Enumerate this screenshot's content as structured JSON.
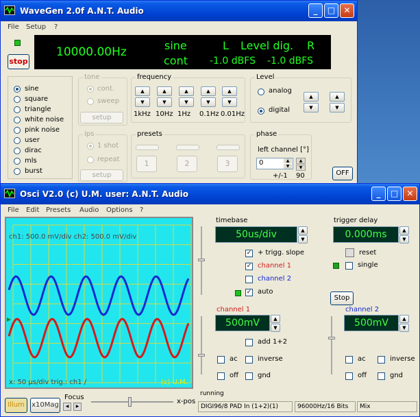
{
  "wavegen": {
    "title": "WaveGen 2.0f  A.N.T. Audio",
    "menu": [
      "File",
      "Setup",
      "?"
    ],
    "stop_label": "stop",
    "display": {
      "freq": "10000.00Hz",
      "wave": "sine",
      "mode": "cont",
      "l": "L",
      "level_label": "Level dig.",
      "r": "R",
      "l_val": "-1.0 dBFS",
      "r_val": "-1.0 dBFS"
    },
    "waveforms": [
      "sine",
      "square",
      "triangle",
      "white noise",
      "pink noise",
      "user",
      "dirac",
      "mls",
      "burst"
    ],
    "selected_wave": "sine",
    "tone": {
      "caption": "tone",
      "options": [
        "cont.",
        "sweep"
      ],
      "setup": "setup"
    },
    "frequency": {
      "caption": "frequency",
      "steps": [
        "1kHz",
        "10Hz",
        "1Hz",
        "0.1Hz",
        "0.01Hz"
      ]
    },
    "level": {
      "caption": "Level",
      "options": [
        "analog",
        "digital"
      ]
    },
    "ips": {
      "caption": "ips",
      "options": [
        "1 shot",
        "repeat"
      ],
      "setup": "setup"
    },
    "presets": {
      "caption": "presets",
      "buttons": [
        "1",
        "2",
        "3"
      ]
    },
    "phase": {
      "caption": "phase",
      "left_label": "left channel [°]",
      "value": "0",
      "minus": "+/-1",
      "deg": "90"
    },
    "off_label": "OFF"
  },
  "osci": {
    "title": "Osci V2.0  (c) U.M.  user: A.N.T. Audio",
    "menu": [
      "File",
      "Edit",
      "Presets",
      "Audio",
      "Options",
      "?"
    ],
    "screen": {
      "header": "ch1: 500.0 mV/div  ch2: 500.0 mV/div",
      "footer": "x: 50 µs/div  trig.: ch1 /",
      "copyright": "(c) U.M."
    },
    "timebase": {
      "caption": "timebase",
      "value": "50us/div"
    },
    "trigger": {
      "caption": "trigger delay",
      "value": "0.000ms",
      "reset": "reset",
      "single": "single"
    },
    "checks": {
      "slope": "+ trigg. slope",
      "ch1": "channel 1",
      "ch2": "channel 2",
      "auto": "auto"
    },
    "stop_label": "Stop",
    "ch1": {
      "caption": "channel 1",
      "value": "500mV",
      "add": "add 1+2",
      "ac": "ac",
      "inverse": "inverse",
      "off": "off",
      "gnd": "gnd"
    },
    "ch2": {
      "caption": "channel 2",
      "value": "500mV",
      "ac": "ac",
      "inverse": "inverse",
      "off": "off",
      "gnd": "gnd"
    },
    "bottom": {
      "illum": "Illum",
      "mag": "x10Mag",
      "focus": "Focus",
      "xpos": "x-pos"
    },
    "status": {
      "running": "running",
      "device": "DIGI96/8 PAD In (1+2)(1)",
      "format": "96000Hz/16 Bits",
      "mix": "Mix"
    },
    "colors": {
      "ch1": "#d01c1c",
      "ch2": "#1428d2",
      "screen": "#22e6ee",
      "grid": "#d8d840"
    }
  }
}
